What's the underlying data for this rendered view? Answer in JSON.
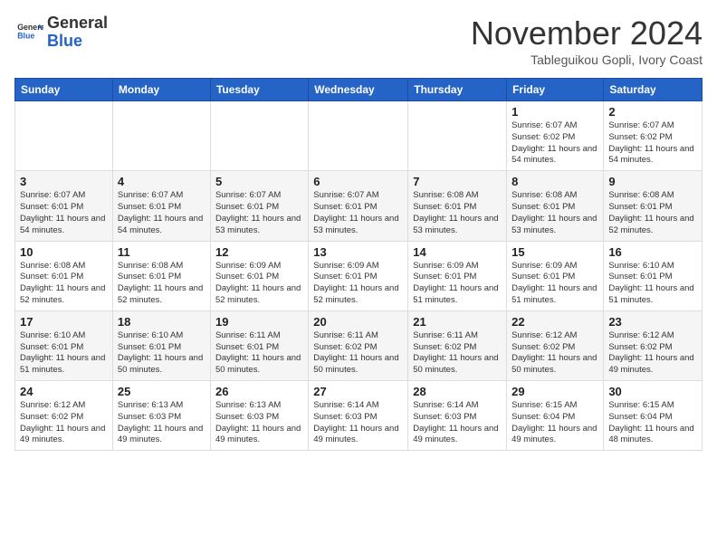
{
  "logo": {
    "general": "General",
    "blue": "Blue"
  },
  "header": {
    "month": "November 2024",
    "location": "Tableguikou Gopli, Ivory Coast"
  },
  "weekdays": [
    "Sunday",
    "Monday",
    "Tuesday",
    "Wednesday",
    "Thursday",
    "Friday",
    "Saturday"
  ],
  "weeks": [
    [
      {
        "day": "",
        "info": ""
      },
      {
        "day": "",
        "info": ""
      },
      {
        "day": "",
        "info": ""
      },
      {
        "day": "",
        "info": ""
      },
      {
        "day": "",
        "info": ""
      },
      {
        "day": "1",
        "info": "Sunrise: 6:07 AM\nSunset: 6:02 PM\nDaylight: 11 hours and 54 minutes."
      },
      {
        "day": "2",
        "info": "Sunrise: 6:07 AM\nSunset: 6:02 PM\nDaylight: 11 hours and 54 minutes."
      }
    ],
    [
      {
        "day": "3",
        "info": "Sunrise: 6:07 AM\nSunset: 6:01 PM\nDaylight: 11 hours and 54 minutes."
      },
      {
        "day": "4",
        "info": "Sunrise: 6:07 AM\nSunset: 6:01 PM\nDaylight: 11 hours and 54 minutes."
      },
      {
        "day": "5",
        "info": "Sunrise: 6:07 AM\nSunset: 6:01 PM\nDaylight: 11 hours and 53 minutes."
      },
      {
        "day": "6",
        "info": "Sunrise: 6:07 AM\nSunset: 6:01 PM\nDaylight: 11 hours and 53 minutes."
      },
      {
        "day": "7",
        "info": "Sunrise: 6:08 AM\nSunset: 6:01 PM\nDaylight: 11 hours and 53 minutes."
      },
      {
        "day": "8",
        "info": "Sunrise: 6:08 AM\nSunset: 6:01 PM\nDaylight: 11 hours and 53 minutes."
      },
      {
        "day": "9",
        "info": "Sunrise: 6:08 AM\nSunset: 6:01 PM\nDaylight: 11 hours and 52 minutes."
      }
    ],
    [
      {
        "day": "10",
        "info": "Sunrise: 6:08 AM\nSunset: 6:01 PM\nDaylight: 11 hours and 52 minutes."
      },
      {
        "day": "11",
        "info": "Sunrise: 6:08 AM\nSunset: 6:01 PM\nDaylight: 11 hours and 52 minutes."
      },
      {
        "day": "12",
        "info": "Sunrise: 6:09 AM\nSunset: 6:01 PM\nDaylight: 11 hours and 52 minutes."
      },
      {
        "day": "13",
        "info": "Sunrise: 6:09 AM\nSunset: 6:01 PM\nDaylight: 11 hours and 52 minutes."
      },
      {
        "day": "14",
        "info": "Sunrise: 6:09 AM\nSunset: 6:01 PM\nDaylight: 11 hours and 51 minutes."
      },
      {
        "day": "15",
        "info": "Sunrise: 6:09 AM\nSunset: 6:01 PM\nDaylight: 11 hours and 51 minutes."
      },
      {
        "day": "16",
        "info": "Sunrise: 6:10 AM\nSunset: 6:01 PM\nDaylight: 11 hours and 51 minutes."
      }
    ],
    [
      {
        "day": "17",
        "info": "Sunrise: 6:10 AM\nSunset: 6:01 PM\nDaylight: 11 hours and 51 minutes."
      },
      {
        "day": "18",
        "info": "Sunrise: 6:10 AM\nSunset: 6:01 PM\nDaylight: 11 hours and 50 minutes."
      },
      {
        "day": "19",
        "info": "Sunrise: 6:11 AM\nSunset: 6:01 PM\nDaylight: 11 hours and 50 minutes."
      },
      {
        "day": "20",
        "info": "Sunrise: 6:11 AM\nSunset: 6:02 PM\nDaylight: 11 hours and 50 minutes."
      },
      {
        "day": "21",
        "info": "Sunrise: 6:11 AM\nSunset: 6:02 PM\nDaylight: 11 hours and 50 minutes."
      },
      {
        "day": "22",
        "info": "Sunrise: 6:12 AM\nSunset: 6:02 PM\nDaylight: 11 hours and 50 minutes."
      },
      {
        "day": "23",
        "info": "Sunrise: 6:12 AM\nSunset: 6:02 PM\nDaylight: 11 hours and 49 minutes."
      }
    ],
    [
      {
        "day": "24",
        "info": "Sunrise: 6:12 AM\nSunset: 6:02 PM\nDaylight: 11 hours and 49 minutes."
      },
      {
        "day": "25",
        "info": "Sunrise: 6:13 AM\nSunset: 6:03 PM\nDaylight: 11 hours and 49 minutes."
      },
      {
        "day": "26",
        "info": "Sunrise: 6:13 AM\nSunset: 6:03 PM\nDaylight: 11 hours and 49 minutes."
      },
      {
        "day": "27",
        "info": "Sunrise: 6:14 AM\nSunset: 6:03 PM\nDaylight: 11 hours and 49 minutes."
      },
      {
        "day": "28",
        "info": "Sunrise: 6:14 AM\nSunset: 6:03 PM\nDaylight: 11 hours and 49 minutes."
      },
      {
        "day": "29",
        "info": "Sunrise: 6:15 AM\nSunset: 6:04 PM\nDaylight: 11 hours and 49 minutes."
      },
      {
        "day": "30",
        "info": "Sunrise: 6:15 AM\nSunset: 6:04 PM\nDaylight: 11 hours and 48 minutes."
      }
    ]
  ]
}
